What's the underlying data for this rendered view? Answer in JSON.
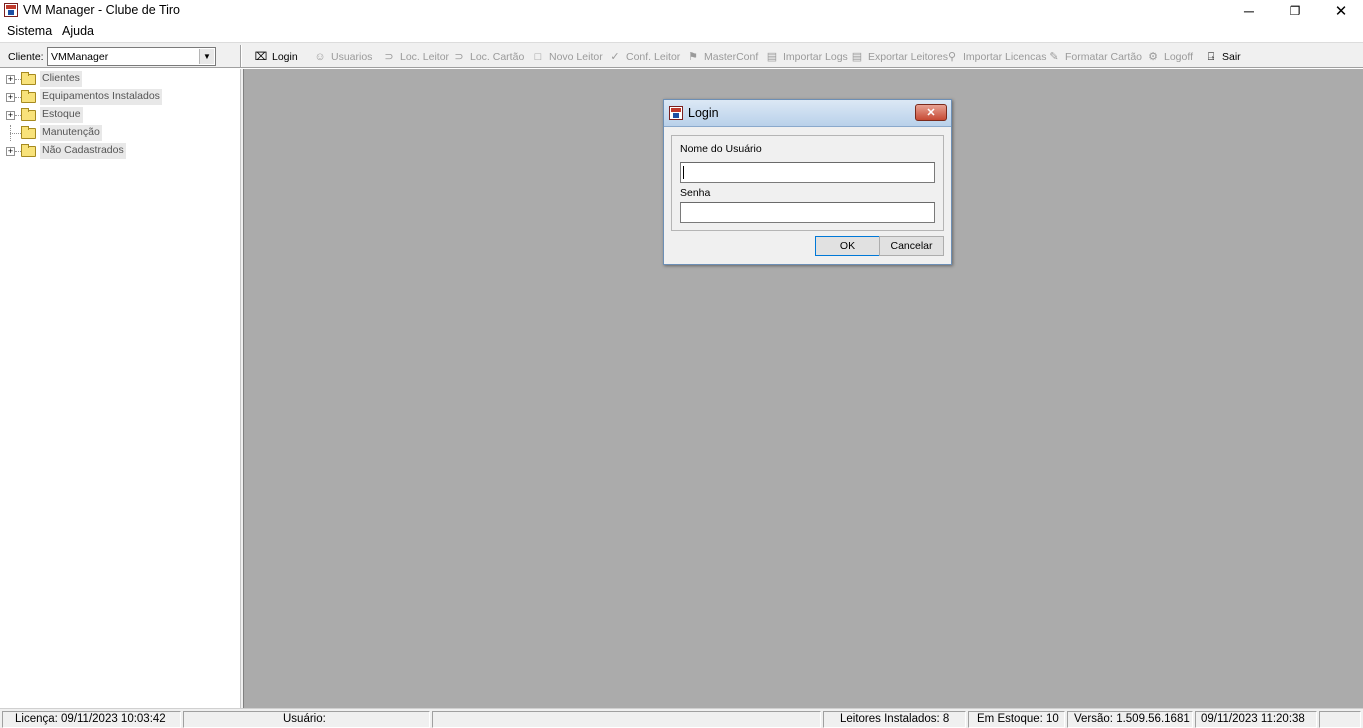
{
  "window": {
    "title": "VM Manager - Clube de Tiro",
    "minimize_glyph": "─",
    "maximize_glyph": "❐",
    "close_glyph": "✕"
  },
  "menu": {
    "items": [
      "Sistema",
      "Ajuda"
    ]
  },
  "toolbar": {
    "cliente_label": "Cliente:",
    "cliente_value": "VMManager",
    "dropdown_glyph": "▼",
    "buttons": [
      {
        "label": "Login",
        "icon": "login-icon",
        "glyph": "⌧",
        "enabled": true
      },
      {
        "label": "Usuarios",
        "icon": "users-icon",
        "glyph": "☺",
        "enabled": false
      },
      {
        "label": "Loc. Leitor",
        "icon": "locate-reader-icon",
        "glyph": "⊃",
        "enabled": false
      },
      {
        "label": "Loc. Cartão",
        "icon": "locate-card-icon",
        "glyph": "⊃",
        "enabled": false
      },
      {
        "label": "Novo Leitor",
        "icon": "new-reader-icon",
        "glyph": "□",
        "enabled": false
      },
      {
        "label": "Conf. Leitor",
        "icon": "configure-reader-icon",
        "glyph": "✓",
        "enabled": false
      },
      {
        "label": "MasterConf",
        "icon": "masterconf-icon",
        "glyph": "⚑",
        "enabled": false
      },
      {
        "label": "Importar Logs",
        "icon": "import-logs-icon",
        "glyph": "▤",
        "enabled": false
      },
      {
        "label": "Exportar Leitores",
        "icon": "export-readers-icon",
        "glyph": "▤",
        "enabled": false
      },
      {
        "label": "Importar Licencas",
        "icon": "import-licenses-icon",
        "glyph": "⚲",
        "enabled": false
      },
      {
        "label": "Formatar Cartão",
        "icon": "format-card-icon",
        "glyph": "✎",
        "enabled": false
      },
      {
        "label": "Logoff",
        "icon": "logoff-icon",
        "glyph": "⚙",
        "enabled": false
      },
      {
        "label": "Sair",
        "icon": "exit-door-icon",
        "glyph": "⍈",
        "enabled": true
      }
    ]
  },
  "tree": {
    "expand_glyph": "+",
    "nodes": [
      {
        "label": "Clientes",
        "expandable": true
      },
      {
        "label": "Equipamentos Instalados",
        "expandable": true
      },
      {
        "label": "Estoque",
        "expandable": true
      },
      {
        "label": "Manutenção",
        "expandable": false
      },
      {
        "label": "Não Cadastrados",
        "expandable": true
      }
    ]
  },
  "login_dialog": {
    "title": "Login",
    "close_glyph": "✕",
    "username_label": "Nome do Usuário",
    "username_value": "",
    "password_label": "Senha",
    "password_value": "",
    "ok_label": "OK",
    "cancel_label": "Cancelar"
  },
  "status": {
    "license": "Licença: 09/11/2023 10:03:42",
    "user": "Usuário:",
    "installed_readers": "Leitores Instalados: 8",
    "in_stock": "Em Estoque: 10",
    "version": "Versão: 1.509.56.1681",
    "datetime": "09/11/2023  11:20:38"
  }
}
